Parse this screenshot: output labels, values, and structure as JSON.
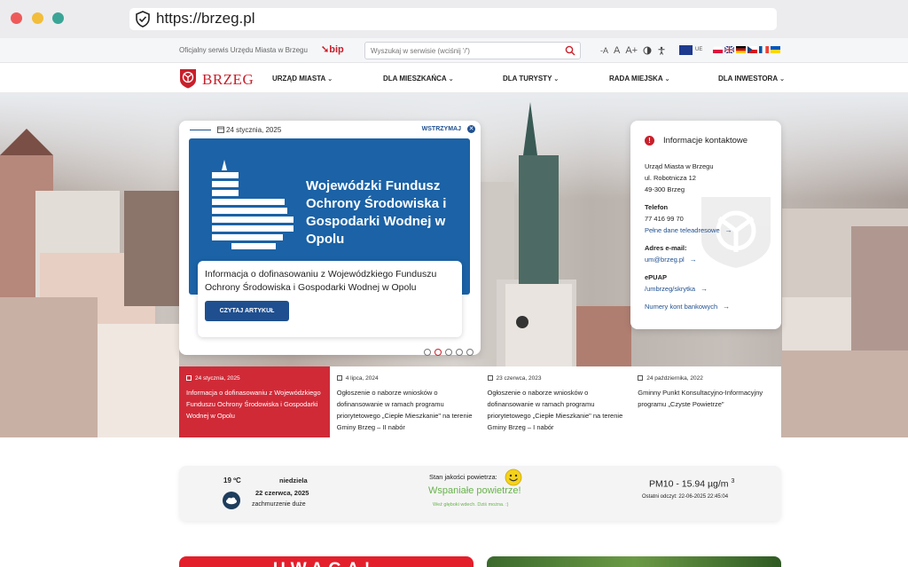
{
  "browser": {
    "url": "https://brzeg.pl"
  },
  "topbar": {
    "official": "Oficjalny serwis Urzędu Miasta w Brzegu",
    "bip": "bip",
    "search_placeholder": "Wyszukaj w serwisie (wciśnij '/')",
    "font_small": "-A",
    "font_normal": "A",
    "font_big": "A+",
    "ue_label": "UE"
  },
  "nav": {
    "logo_text": "BRZEG",
    "items": [
      {
        "label": "URZĄD MIASTA"
      },
      {
        "label": "DLA MIESZKAŃCA"
      },
      {
        "label": "DLA TURYSTY"
      },
      {
        "label": "RADA MIEJSKA"
      },
      {
        "label": "DLA INWESTORA"
      }
    ]
  },
  "slider": {
    "date": "24 stycznia, 2025",
    "pause_label": "WSTRZYMAJ",
    "banner_title": "Wojewódzki Fundusz Ochrony Środowiska i Gospodarki Wodnej w Opolu",
    "box_title": "Informacja o dofinasowaniu z Wojewódzkiego Funduszu Ochrony Środowiska i Gospodarki Wodnej w Opolu",
    "read_label": "CZYTAJ ARTYKUŁ"
  },
  "contact": {
    "title": "Informacje kontaktowe",
    "org": "Urząd Miasta w Brzegu",
    "street": "ul. Robotnicza 12",
    "city": "49-300 Brzeg",
    "phone_label": "Telefon",
    "phone": "77 416 99 70",
    "phone_link": "Pełne dane teleadresowe",
    "email_label": "Adres e-mail:",
    "email": "um@brzeg.pl",
    "epuap_label": "ePUAP",
    "epuap": "/umbrzeg/skrytka",
    "bank_link": "Numery kont bankowych"
  },
  "news": [
    {
      "date": "24 stycznia, 2025",
      "title": "Informacja o dofinasowaniu z Wojewódzkiego Funduszu Ochrony Środowiska i Gospodarki Wodnej w Opolu"
    },
    {
      "date": "4 lipca, 2024",
      "title": "Ogłoszenie o naborze wniosków o dofinansowanie w ramach programu priorytetowego „Ciepłe Mieszkanie\" na terenie Gminy Brzeg – II nabór"
    },
    {
      "date": "23 czerwca, 2023",
      "title": "Ogłoszenie o naborze wniosków o dofinansowanie w ramach programu priorytetowego „Ciepłe Mieszkanie\" na terenie Gminy Brzeg – I nabór"
    },
    {
      "date": "24 października, 2022",
      "title": "Gminny Punkt Konsultacyjno-Informacyjny programu „Czyste Powietrze\""
    }
  ],
  "weather": {
    "temp": "19 ºC",
    "day": "niedziela",
    "date": "22 czerwca, 2025",
    "cond": "zachmurzenie duże",
    "aq_label": "Stan jakości powietrza:",
    "aq_value": "Wspaniałe powietrze!",
    "aq_sub": "Weź głęboki wdech. Dziś można. :)",
    "pm": "PM10 - 15.94 µg/m",
    "pm_sup": "3",
    "updated": "Ostatni odczyt: 22-06-2025 22:45:04"
  },
  "alert": {
    "text": "UWAGA!"
  },
  "colors": {
    "brand_red": "#c8202b",
    "brand_blue": "#1f4f8f",
    "banner_blue": "#1b62a6",
    "air_green": "#68b34b"
  }
}
